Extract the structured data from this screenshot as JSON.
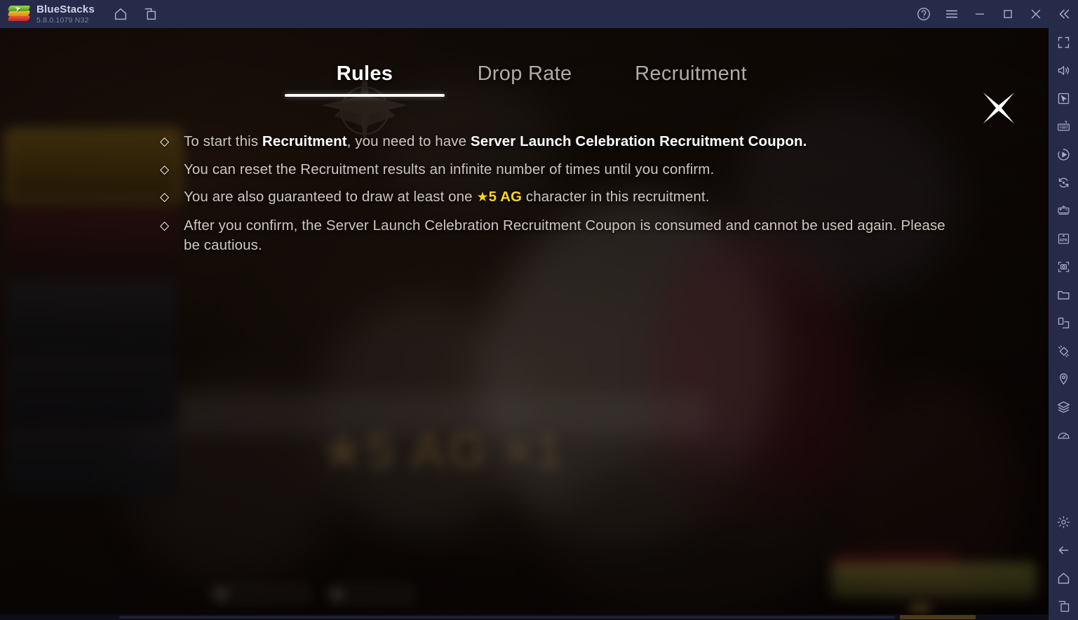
{
  "titlebar": {
    "app_name": "BlueStacks",
    "version": "5.8.0.1079  N32",
    "icons": [
      {
        "name": "home-icon",
        "glyph": "home"
      },
      {
        "name": "multi-instance-icon",
        "glyph": "windows"
      }
    ],
    "window_controls": [
      {
        "name": "help-icon",
        "glyph": "?"
      },
      {
        "name": "menu-icon",
        "glyph": "hamburger"
      },
      {
        "name": "minimize-icon",
        "glyph": "minimize"
      },
      {
        "name": "maximize-icon",
        "glyph": "maximize"
      },
      {
        "name": "close-icon",
        "glyph": "close"
      },
      {
        "name": "collapse-sidebar-icon",
        "glyph": "chevrons-left"
      }
    ]
  },
  "toolbar": {
    "items": [
      {
        "name": "fullscreen-icon"
      },
      {
        "name": "volume-icon"
      },
      {
        "name": "cursor-pointer-icon"
      },
      {
        "name": "keyboard-controls-icon"
      },
      {
        "name": "macro-recorder-icon"
      },
      {
        "name": "rotate-screen-icon"
      },
      {
        "name": "gamepad-icon"
      },
      {
        "name": "install-apk-icon"
      },
      {
        "name": "screenshot-icon"
      },
      {
        "name": "media-folder-icon"
      },
      {
        "name": "multi-instance-sync-icon"
      },
      {
        "name": "shake-icon"
      },
      {
        "name": "location-icon"
      },
      {
        "name": "layers-icon"
      },
      {
        "name": "performance-meter-icon"
      },
      {
        "name": "settings-gear-icon"
      },
      {
        "name": "back-icon"
      },
      {
        "name": "home-nav-icon"
      },
      {
        "name": "recent-apps-icon"
      }
    ]
  },
  "modal": {
    "tabs": [
      {
        "label": "Rules",
        "active": true
      },
      {
        "label": "Drop Rate",
        "active": false
      },
      {
        "label": "Recruitment",
        "active": false
      }
    ],
    "close_label": "×",
    "bullet": "◇",
    "rules": [
      {
        "id": "rule-1",
        "parts": [
          {
            "t": "To start this ",
            "s": "dim"
          },
          {
            "t": "Recruitment",
            "s": "bold"
          },
          {
            "t": ", you need to have ",
            "s": "dim"
          },
          {
            "t": "Server Launch Celebration Recruitment Coupon.",
            "s": "bold"
          }
        ]
      },
      {
        "id": "rule-2",
        "parts": [
          {
            "t": "You can reset the Recruitment results an infinite number of times until you confirm.",
            "s": "dim"
          }
        ]
      },
      {
        "id": "rule-3",
        "parts": [
          {
            "t": "You are also guaranteed to draw at least one ",
            "s": "dim"
          },
          {
            "t": "★",
            "s": "star"
          },
          {
            "t": "5 AG",
            "s": "highlight"
          },
          {
            "t": " character in this recruitment.",
            "s": "dim"
          }
        ]
      },
      {
        "id": "rule-4",
        "parts": [
          {
            "t": "After you confirm, the Server Launch Celebration Recruitment Coupon is consumed and cannot be used again. Please be cautious.",
            "s": "dim"
          }
        ]
      }
    ]
  },
  "background": {
    "banner_title": "★5 AG ×1",
    "banner_sub": ""
  },
  "colors": {
    "titlebar_bg": "#262b4a",
    "toolbar_bg": "#262b4a",
    "tab_active": "#ffffff",
    "tab_inactive": "#b3aaa2",
    "rule_text": "#cfc6bd",
    "highlight_yellow": "#ffd51e",
    "panel_base": "#1b110a"
  }
}
